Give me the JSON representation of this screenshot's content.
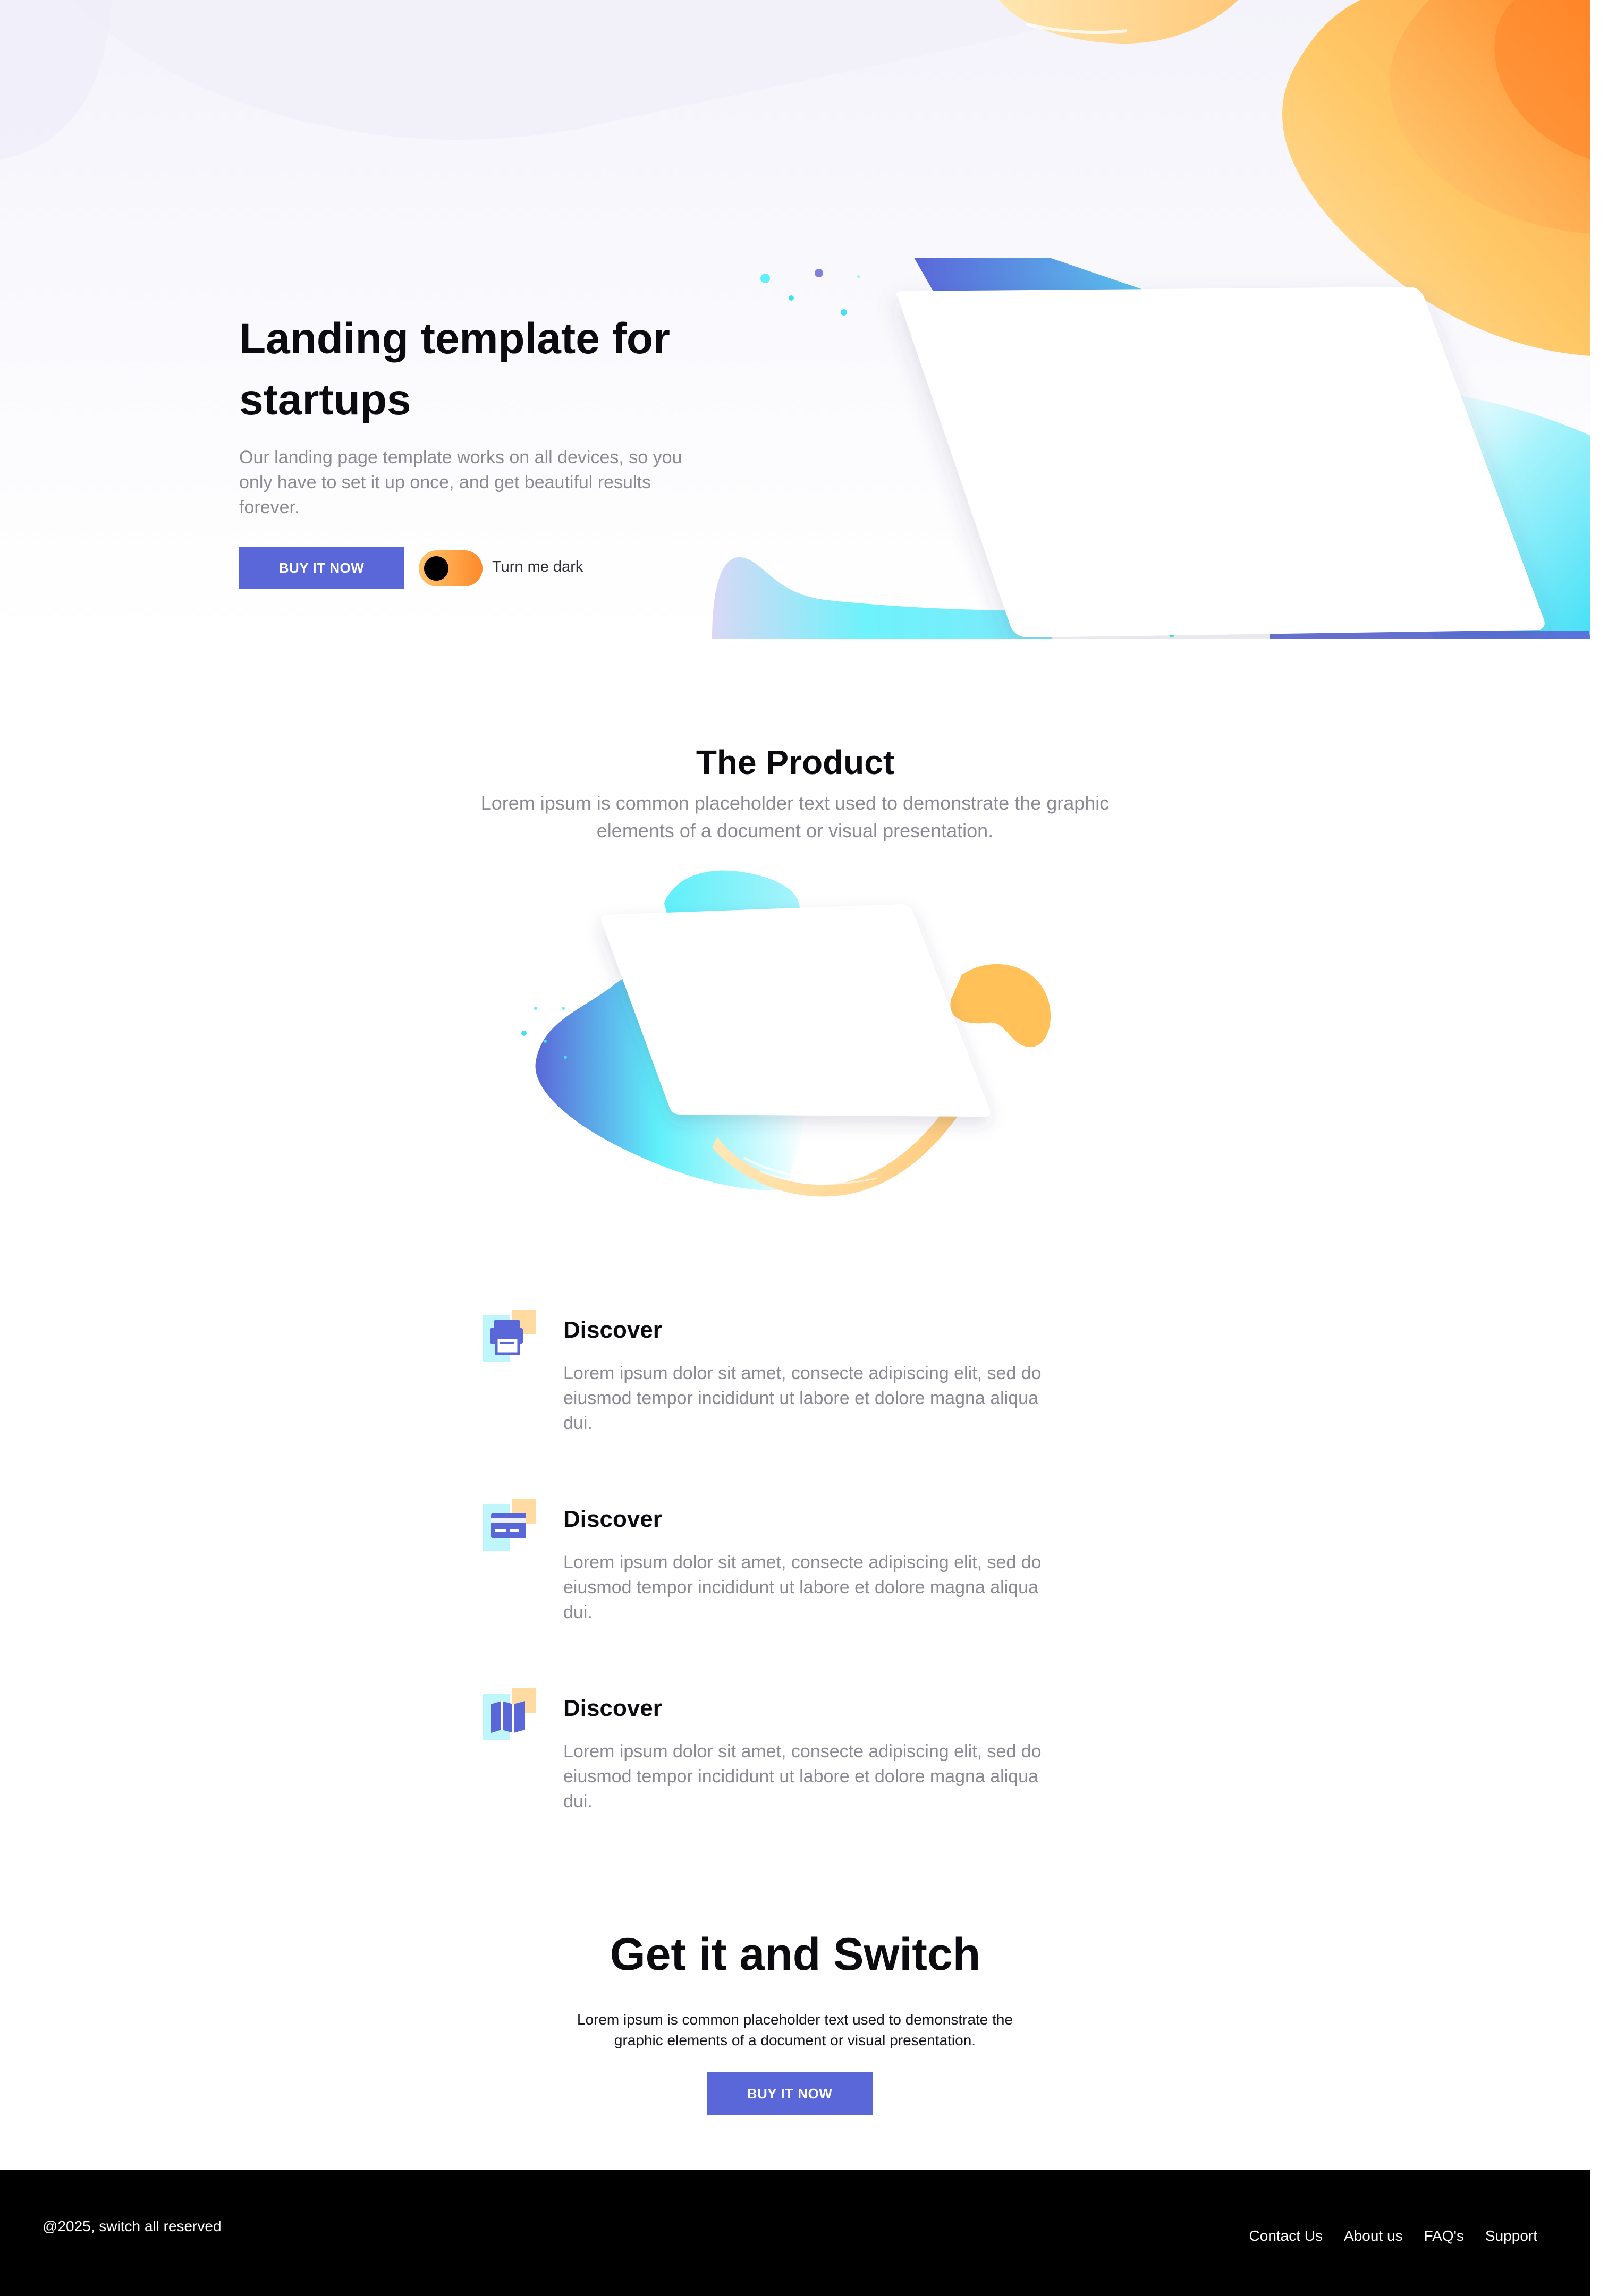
{
  "hero": {
    "title": "Landing template for startups",
    "description": "Our landing page template works on all devices, so you only have to set it up once, and get beautiful results forever.",
    "buy_label": "BUY IT NOW",
    "toggle_label": "Turn me dark"
  },
  "product": {
    "title": "The Product",
    "description": "Lorem ipsum is common placeholder text used to demonstrate the graphic elements of a document or visual presentation."
  },
  "features": [
    {
      "icon": "printer-icon",
      "title": "Discover",
      "description": "Lorem ipsum dolor sit amet, consecte adipiscing elit, sed do eiusmod tempor incididunt ut labore et dolore magna aliqua dui."
    },
    {
      "icon": "credit-card-icon",
      "title": "Discover",
      "description": "Lorem ipsum dolor sit amet, consecte adipiscing elit, sed do eiusmod tempor incididunt ut labore et dolore magna aliqua dui."
    },
    {
      "icon": "map-icon",
      "title": "Discover",
      "description": "Lorem ipsum dolor sit amet, consecte adipiscing elit, sed do eiusmod tempor incididunt ut labore et dolore magna aliqua dui."
    }
  ],
  "cta": {
    "title": "Get it and Switch",
    "description": "Lorem ipsum is common placeholder text used to demonstrate the graphic elements of a document or visual presentation.",
    "buy_label": "BUY IT NOW"
  },
  "footer": {
    "copyright": "@2025, switch all reserved",
    "links": [
      "Contact Us",
      "About us",
      "FAQ's",
      "Support"
    ]
  },
  "colors": {
    "primary": "#5a67d8",
    "accent_orange": "#ff8a2a",
    "accent_yellow": "#ffc36b",
    "accent_cyan": "#5ff0fa",
    "text_dark": "#0b0b10",
    "text_muted": "#8a8a93",
    "footer_bg": "#000000"
  }
}
